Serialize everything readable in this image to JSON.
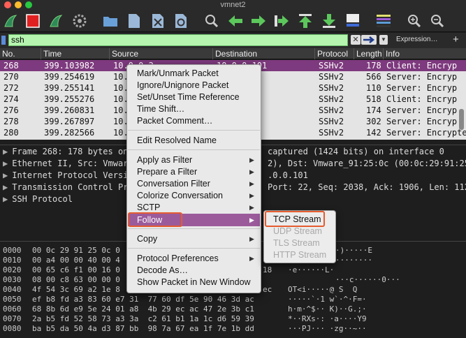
{
  "window": {
    "title": "vmnet2",
    "traffic_colors": [
      "#ff5f57",
      "#febc2e",
      "#28c840"
    ]
  },
  "toolbar": {
    "icons": [
      "shark-fin-icon",
      "stop-capture-icon",
      "restart-capture-icon",
      "capture-options-icon",
      "open-folder-icon",
      "save-file-icon",
      "close-file-icon",
      "reload-icon",
      "find-icon",
      "go-back-icon",
      "go-forward-icon",
      "go-to-packet-icon",
      "go-first-icon",
      "go-last-icon",
      "autoscroll-icon",
      "colorize-icon",
      "zoom-in-icon",
      "zoom-out-icon"
    ]
  },
  "filter": {
    "value": "ssh",
    "clear_label": "✕",
    "expression_label": "Expression…",
    "plus_label": "+"
  },
  "columns": [
    "No.",
    "Time",
    "Source",
    "Destination",
    "Protocol",
    "Length",
    "Info"
  ],
  "packets": [
    {
      "no": "268",
      "time": "399.103982",
      "src": "10.0.0.2",
      "dst": "10.0.0.101",
      "proto": "SSHv2",
      "len": "178",
      "info": "Client: Encryp",
      "selected": true
    },
    {
      "no": "270",
      "time": "399.254619",
      "src": "10.",
      "dst": "",
      "proto": "SSHv2",
      "len": "566",
      "info": "Server: Encryp",
      "selected": false
    },
    {
      "no": "272",
      "time": "399.255141",
      "src": "10.",
      "dst": "",
      "proto": "SSHv2",
      "len": "110",
      "info": "Server: Encryp",
      "selected": false
    },
    {
      "no": "274",
      "time": "399.255276",
      "src": "10.",
      "dst": "1",
      "proto": "SSHv2",
      "len": "518",
      "info": "Client: Encryp",
      "selected": false
    },
    {
      "no": "276",
      "time": "399.260831",
      "src": "10.",
      "dst": "",
      "proto": "SSHv2",
      "len": "174",
      "info": "Server: Encryp",
      "selected": false
    },
    {
      "no": "278",
      "time": "399.267897",
      "src": "10.",
      "dst": "",
      "proto": "SSHv2",
      "len": "302",
      "info": "Server: Encryp",
      "selected": false
    },
    {
      "no": "280",
      "time": "399.282566",
      "src": "10.",
      "dst": "",
      "proto": "SSHv2",
      "len": "142",
      "info": "Server: Encrypte",
      "selected": false
    }
  ],
  "details": [
    {
      "left": "Frame 268: 178 bytes on",
      "right": "captured (1424 bits) on interface 0"
    },
    {
      "left": "Ethernet II, Src: Vmwar",
      "right": "2), Dst: Vmware_91:25:0c (00:0c:29:91:25:0"
    },
    {
      "left": "Internet Protocol Versi",
      "right": ".0.0.101"
    },
    {
      "left": "Transmission Control Pr",
      "right": "Port: 22, Seq: 2038, Ack: 1906, Len: 112"
    },
    {
      "left": "SSH Protocol",
      "right": ""
    }
  ],
  "bytes": [
    {
      "off": "0000",
      "hex": "00 0c 29 91 25 0c 0",
      "tail": "",
      "ascii": "·)·····E"
    },
    {
      "off": "0010",
      "hex": "00 a4 00 00 40 00 4",
      "tail": "",
      "ascii": "········"
    },
    {
      "off": "0020",
      "hex": "00 65 c6 f1 00 16 0",
      "tail": "18",
      "ascii": "·e······L·"
    },
    {
      "off": "0030",
      "hex": "08 00 c8 63 00 00 0",
      "tail": "",
      "ascii": "···c······0···"
    },
    {
      "off": "0040",
      "hex": "4f 54 3c 69 a2 1e 8",
      "tail": "ec",
      "ascii": "OT<i·····@ S  Q"
    },
    {
      "off": "0050",
      "hex": "ef b8 fd a3 83 60 e7 31  77 60 df 5e 90 46 3d ac",
      "tail": "",
      "ascii": "·····`·1 w`·^·F=·"
    },
    {
      "off": "0060",
      "hex": "68 8b 6d e9 5e 24 01 a8  4b 29 ec ac 47 2e 3b c1",
      "tail": "",
      "ascii": "h·m·^$·· K)··G.;·"
    },
    {
      "off": "0070",
      "hex": "2a b5 fd 52 58 73 a3 3a  c2 61 b1 1a 1c d6 59 39",
      "tail": "",
      "ascii": "*··RXs·: ·a····Y9"
    },
    {
      "off": "0080",
      "hex": "ba b5 da 50 4a d3 87 bb  98 7a 67 ea 1f 7e 1b dd",
      "tail": "",
      "ascii": "···PJ··· ·zg··~··"
    }
  ],
  "context_menu": {
    "items": [
      {
        "label": "Mark/Unmark Packet",
        "submenu": false
      },
      {
        "label": "Ignore/Unignore Packet",
        "submenu": false
      },
      {
        "label": "Set/Unset Time Reference",
        "submenu": false
      },
      {
        "label": "Time Shift…",
        "submenu": false
      },
      {
        "label": "Packet Comment…",
        "submenu": false
      },
      {
        "label": "Edit Resolved Name",
        "submenu": false
      },
      {
        "label": "Apply as Filter",
        "submenu": true
      },
      {
        "label": "Prepare a Filter",
        "submenu": true
      },
      {
        "label": "Conversation Filter",
        "submenu": true
      },
      {
        "label": "Colorize Conversation",
        "submenu": true
      },
      {
        "label": "SCTP",
        "submenu": true
      },
      {
        "label": "Follow",
        "submenu": true
      },
      {
        "label": "Copy",
        "submenu": true
      },
      {
        "label": "Protocol Preferences",
        "submenu": true
      },
      {
        "label": "Decode As…",
        "submenu": false
      },
      {
        "label": "Show Packet in New Window",
        "submenu": false
      }
    ]
  },
  "follow_submenu": {
    "items": [
      {
        "label": "TCP Stream",
        "enabled": true
      },
      {
        "label": "UDP Stream",
        "enabled": false
      },
      {
        "label": "TLS Stream",
        "enabled": false
      },
      {
        "label": "HTTP Stream",
        "enabled": false
      }
    ]
  },
  "colors": {
    "selected_row": "#7e3a7e",
    "menu_highlight": "#9b5b9b",
    "annotation": "#e55b2e",
    "filter_bg": "#b6f5b0"
  }
}
